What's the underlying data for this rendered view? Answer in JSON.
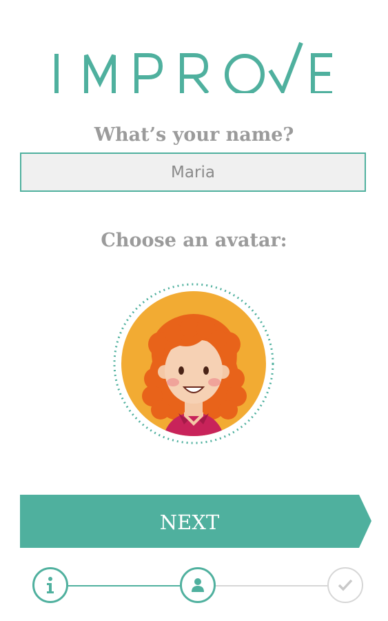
{
  "app": {
    "logo_text": "IMPROVE"
  },
  "colors": {
    "accent": "#4fb09e",
    "label": "#9b9b9b",
    "field_bg": "#f0f0f0",
    "inactive": "#d6d6d6"
  },
  "form": {
    "name_label": "What’s your name?",
    "name_value": "Maria",
    "avatar_label": "Choose an avatar:"
  },
  "avatar": {
    "name": "redhead-girl-avatar",
    "selected": true
  },
  "actions": {
    "next_label": "NEXT"
  },
  "progress": {
    "steps": [
      {
        "name": "info",
        "icon": "info-icon",
        "state": "done"
      },
      {
        "name": "profile",
        "icon": "user-icon",
        "state": "current"
      },
      {
        "name": "finish",
        "icon": "check-icon",
        "state": "pending"
      }
    ]
  }
}
